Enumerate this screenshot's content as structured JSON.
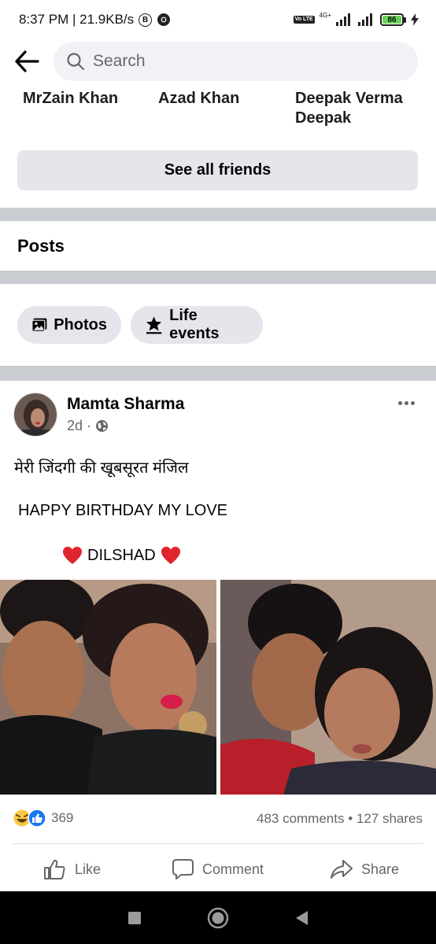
{
  "status_bar": {
    "time_network": "8:37 PM | 21.9KB/s",
    "b_badge": "B",
    "volte": "Vo LTE",
    "net_type": "4G+",
    "battery": "86"
  },
  "search": {
    "placeholder": "Search"
  },
  "friends": {
    "names": [
      "MrZain Khan",
      "Azad Khan",
      "Deepak Verma Deepak"
    ],
    "see_all_label": "See all friends"
  },
  "posts_section": {
    "heading": "Posts",
    "chips": [
      "Photos",
      "Life events"
    ]
  },
  "post": {
    "author": "Mamta Sharma",
    "time": "2d",
    "text_line1": "मेरी जिंदगी की खूबसूरत मंजिल",
    "text_line2": "HAPPY BIRTHDAY MY LOVE",
    "text_line3": "DILSHAD",
    "reaction_count": "369",
    "comments_shares": "483 comments • 127 shares",
    "actions": [
      "Like",
      "Comment",
      "Share"
    ]
  },
  "colors": {
    "accent_blue": "#1877f2",
    "separator": "#c9ccd1",
    "chip_bg": "#e4e6eb",
    "secondary_text": "#65676b"
  }
}
